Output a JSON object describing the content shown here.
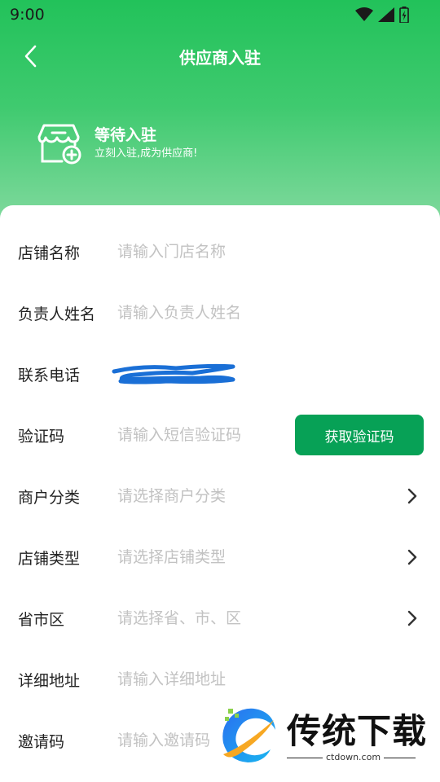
{
  "status_bar": {
    "time": "9:00",
    "icons": [
      "wifi-icon",
      "signal-icon",
      "battery-icon"
    ]
  },
  "nav": {
    "title": "供应商入驻",
    "back_icon": "chevron-left-icon"
  },
  "banner": {
    "icon": "store-add-icon",
    "title": "等待入驻",
    "subtitle": "立刻入驻,成为供应商!"
  },
  "form": {
    "store_name": {
      "label": "店铺名称",
      "placeholder": "请输入门店名称"
    },
    "manager_name": {
      "label": "负责人姓名",
      "placeholder": "请输入负责人姓名"
    },
    "phone": {
      "label": "联系电话",
      "value_redacted": true
    },
    "sms_code": {
      "label": "验证码",
      "placeholder": "请输入短信验证码",
      "button_label": "获取验证码"
    },
    "merchant_category": {
      "label": "商户分类",
      "placeholder": "请选择商户分类"
    },
    "store_type": {
      "label": "店铺类型",
      "placeholder": "请选择店铺类型"
    },
    "region": {
      "label": "省市区",
      "placeholder": "请选择省、市、区"
    },
    "address": {
      "label": "详细地址",
      "placeholder": "请输入详细地址"
    },
    "invite_code": {
      "label": "邀请码",
      "placeholder": "请输入邀请码"
    }
  },
  "watermark": {
    "brand": "传统下载",
    "url": "ctdown.com"
  },
  "colors": {
    "header_top": "#22c25a",
    "header_bottom": "#88dba3",
    "primary_button": "#07a156",
    "placeholder": "#c2c2c2",
    "scribble": "#1a6fd6"
  }
}
